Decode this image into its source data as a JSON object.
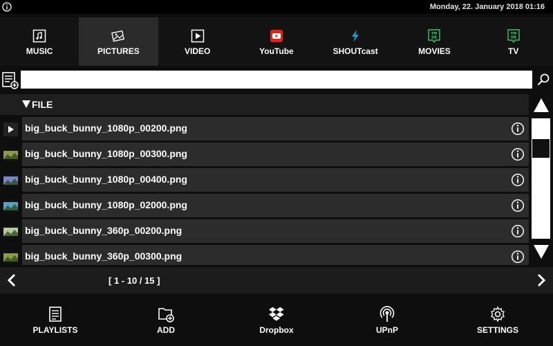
{
  "status": {
    "datetime": "Monday, 22. January 2018 01:16"
  },
  "tabs": [
    {
      "label": "MUSIC",
      "icon": "music-icon",
      "active": false
    },
    {
      "label": "PICTURES",
      "icon": "pictures-icon",
      "active": true
    },
    {
      "label": "VIDEO",
      "icon": "video-icon",
      "active": false
    },
    {
      "label": "YouTube",
      "icon": "youtube-icon",
      "active": false
    },
    {
      "label": "SHOUTcast",
      "icon": "shoutcast-icon",
      "active": false
    },
    {
      "label": "MOVIES",
      "icon": "tmdb-movies-icon",
      "active": false
    },
    {
      "label": "TV",
      "icon": "tmdb-tv-icon",
      "active": false
    }
  ],
  "search": {
    "value": "",
    "placeholder": ""
  },
  "list": {
    "header": "FILE",
    "items": [
      {
        "name": "big_buck_bunny_1080p_00200.png",
        "thumb": "play-thumbnail",
        "color": "#4a4a4a"
      },
      {
        "name": "big_buck_bunny_1080p_00300.png",
        "thumb": "landscape-thumbnail",
        "color": "#8c9a4a"
      },
      {
        "name": "big_buck_bunny_1080p_00400.png",
        "thumb": "landscape-thumbnail",
        "color": "#7a86c8"
      },
      {
        "name": "big_buck_bunny_1080p_02000.png",
        "thumb": "landscape-thumbnail",
        "color": "#5aa0c0"
      },
      {
        "name": "big_buck_bunny_360p_00200.png",
        "thumb": "landscape-thumbnail",
        "color": "#b9c9a0"
      },
      {
        "name": "big_buck_bunny_360p_00300.png",
        "thumb": "landscape-thumbnail",
        "color": "#8c9a4a"
      }
    ]
  },
  "pager": {
    "text": "[ 1 - 10 / 15 ]"
  },
  "bottom": [
    {
      "label": "PLAYLISTS",
      "icon": "playlist-icon"
    },
    {
      "label": "ADD",
      "icon": "add-folder-icon"
    },
    {
      "label": "Dropbox",
      "icon": "dropbox-icon"
    },
    {
      "label": "UPnP",
      "icon": "upnp-icon"
    },
    {
      "label": "SETTINGS",
      "icon": "settings-icon"
    }
  ],
  "colors": {
    "youtube": "#e62117",
    "shoutcast": "#1a9ad6",
    "tmdb": "#3fc36a",
    "active_tab": "#2b2b2b"
  }
}
